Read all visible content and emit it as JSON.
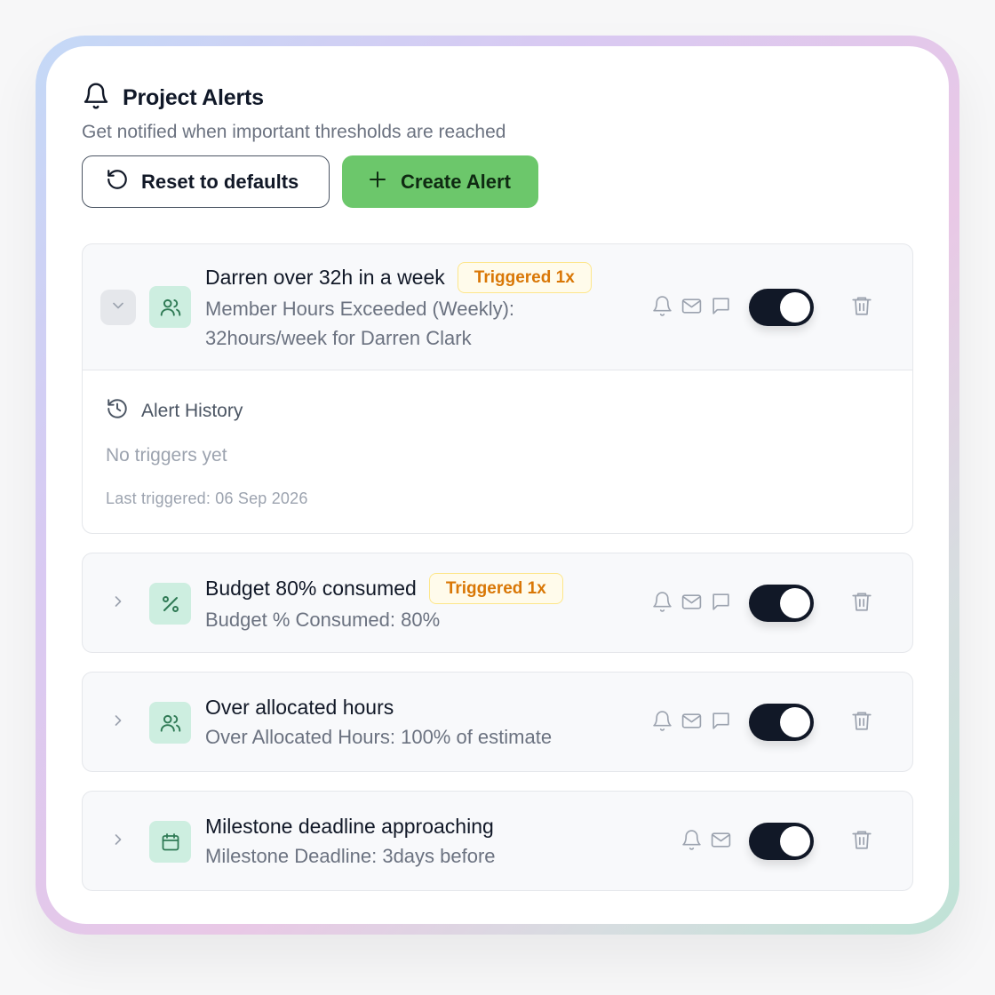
{
  "header": {
    "title": "Project Alerts",
    "subtitle": "Get notified when important thresholds are reached"
  },
  "actions": {
    "reset_label": "Reset to defaults",
    "create_label": "Create Alert"
  },
  "colors": {
    "primary": "#6cc76b",
    "badge_text": "#d97706",
    "icon_bg": "#cdeee0",
    "toggle_on": "#111827"
  },
  "alerts": [
    {
      "name": "Darren over 32h in a week",
      "badge": "Triggered 1x",
      "desc_line1": "Member Hours Exceeded (Weekly):",
      "desc_line2": "32hours/week for Darren Clark",
      "icon": "users-icon",
      "expanded": true,
      "enabled": true,
      "channels": [
        "bell-icon",
        "mail-icon",
        "chat-icon"
      ],
      "history": {
        "title": "Alert History",
        "empty": "No triggers yet",
        "last": "Last triggered: 06 Sep 2026"
      }
    },
    {
      "name": "Budget 80% consumed",
      "badge": "Triggered 1x",
      "desc_line1": "Budget % Consumed: 80%",
      "icon": "percent-icon",
      "expanded": false,
      "enabled": true,
      "channels": [
        "bell-icon",
        "mail-icon",
        "chat-icon"
      ]
    },
    {
      "name": "Over allocated hours",
      "desc_line1": "Over Allocated Hours: 100% of estimate",
      "icon": "users-icon",
      "expanded": false,
      "enabled": true,
      "channels": [
        "bell-icon",
        "mail-icon",
        "chat-icon"
      ]
    },
    {
      "name": "Milestone deadline approaching",
      "desc_line1": "Milestone Deadline: 3days before",
      "icon": "calendar-icon",
      "expanded": false,
      "enabled": true,
      "channels": [
        "bell-icon",
        "mail-icon"
      ]
    }
  ]
}
